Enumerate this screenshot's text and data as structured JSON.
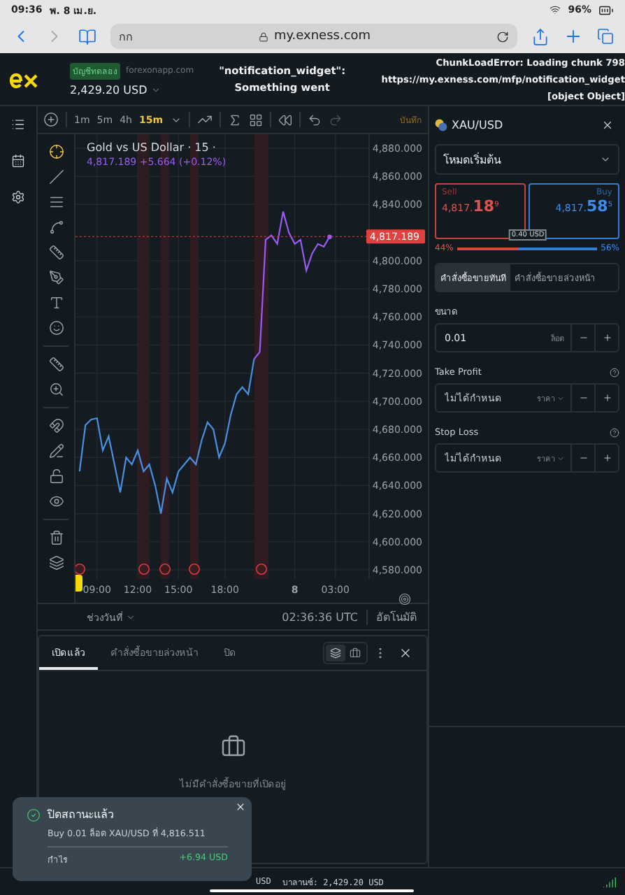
{
  "device_status": {
    "time": "09:36",
    "date": "พ. 8 เม.ย.",
    "battery": "96%"
  },
  "browser": {
    "tab_label": "กก",
    "url": "my.exness.com",
    "back_enabled": true,
    "forward_enabled": false
  },
  "header": {
    "account_badge": "บัญชีทดลอง",
    "domain": "forexonapp.com",
    "balance": "2,429.20 USD",
    "widget_error": [
      "\"notification_widget\":",
      "Something went"
    ],
    "chunk_error": [
      "ChunkLoadError: Loading chunk 798",
      "https://my.exness.com/mfp/notification_widget",
      "[object Object]"
    ]
  },
  "toolbar": {
    "timeframes": [
      {
        "label": "1m",
        "selected": false
      },
      {
        "label": "5m",
        "selected": false
      },
      {
        "label": "4h",
        "selected": false
      },
      {
        "label": "15m",
        "selected": true
      }
    ],
    "save_label": "บันทึก"
  },
  "chart": {
    "title": "Gold vs US Dollar · 15 ·",
    "quote": "4,817.189 +5.664 (+0.12%)",
    "date_range": "ช่วงวันที่",
    "clock": "02:36:36 UTC",
    "scale_mode": "อัตโนมัติ",
    "chart_data": {
      "type": "line",
      "grid": true,
      "ylim": [
        4573.5,
        4890
      ],
      "categories": [
        null,
        null,
        null,
        "09:00",
        null,
        null,
        null,
        null,
        null,
        null,
        "12:00",
        null,
        null,
        null,
        null,
        null,
        null,
        "15:00",
        null,
        null,
        null,
        null,
        null,
        null,
        null,
        "18:00",
        null,
        null,
        null,
        null,
        null,
        null,
        null,
        null,
        null,
        null,
        null,
        "8",
        null,
        null,
        null,
        null,
        null,
        null,
        "03:00"
      ],
      "ref_lines": [
        {
          "axis": "y",
          "value": 4817.189,
          "color": "#cc4444",
          "label": "4,817.189"
        }
      ],
      "yticks": [
        {
          "value": 4880,
          "label": "4,880.000"
        },
        {
          "value": 4860,
          "label": "4,860.000"
        },
        {
          "value": 4840,
          "label": "4,840.000"
        },
        {
          "value": 4800,
          "label": "4,800.000"
        },
        {
          "value": 4780,
          "label": "4,780.000"
        },
        {
          "value": 4760,
          "label": "4,760.000"
        },
        {
          "value": 4740,
          "label": "4,740.000"
        },
        {
          "value": 4720,
          "label": "4,720.000"
        },
        {
          "value": 4700,
          "label": "4,700.000"
        },
        {
          "value": 4680,
          "label": "4,680.000"
        },
        {
          "value": 4660,
          "label": "4,660.000"
        },
        {
          "value": 4640,
          "label": "4,640.000"
        },
        {
          "value": 4620,
          "label": "4,620.000"
        },
        {
          "value": 4600,
          "label": "4,600.000"
        },
        {
          "value": 4580,
          "label": "4,580.000"
        }
      ],
      "series": [
        {
          "color": "#4a90e2",
          "values": [
            4650,
            4683,
            4687,
            4688,
            4665,
            4675,
            4655,
            4635,
            4660,
            4655,
            4665,
            4650,
            4655,
            4640,
            4620,
            4645,
            4635,
            4650,
            4655,
            4660,
            4655,
            4672,
            4685,
            4680,
            4660,
            4670,
            4690,
            4705,
            4710,
            4705,
            4730,
            null,
            null,
            null,
            null,
            null,
            null,
            null,
            null,
            null,
            null,
            null,
            null,
            null,
            null
          ]
        },
        {
          "color": "#9b59f5",
          "values": [
            null,
            null,
            null,
            null,
            null,
            null,
            null,
            null,
            null,
            null,
            null,
            null,
            null,
            null,
            null,
            null,
            null,
            null,
            null,
            null,
            null,
            null,
            null,
            null,
            null,
            null,
            null,
            null,
            null,
            null,
            4730,
            4735,
            4815,
            4818,
            4812,
            4835,
            4820,
            4812,
            4815,
            4793,
            4805,
            4812,
            4810,
            4817,
            null
          ]
        }
      ]
    }
  },
  "trade_panel": {
    "symbol": "XAU/USD",
    "mode": "โหมดเริ่มต้น",
    "sell": {
      "label": "Sell",
      "price": "4,817.**18**$^{9}$"
    },
    "buy": {
      "label": "Buy",
      "price": "4,817.**58**$^{5}$"
    },
    "spread": "0.40 USD",
    "sentiment": {
      "sell_share": "44%",
      "buy_share": "56%",
      "level": 0.44
    },
    "order_tabs": [
      {
        "label": "คำสั่งซื้อขายทันที",
        "selected": true
      },
      {
        "label": "คำสั่งซื้อขายล่วงหน้า",
        "selected": false
      }
    ],
    "fields": [
      {
        "label": "ขนาด",
        "value": "0.01",
        "unit": "ล็อต",
        "help": false,
        "unit_menu": false
      },
      {
        "label": "Take Profit",
        "placeholder": "ไม่ได้กำหนด",
        "unit": "ราคา",
        "help": true,
        "unit_menu": true
      },
      {
        "label": "Stop Loss",
        "placeholder": "ไม่ได้กำหนด",
        "unit": "ราคา",
        "help": true,
        "unit_menu": true
      }
    ]
  },
  "positions": {
    "tabs": [
      {
        "label": "เปิดแล้ว",
        "selected": true
      },
      {
        "label": "คำสั่งซื้อขายล่วงหน้า",
        "selected": false
      },
      {
        "label": "ปิด",
        "selected": false
      }
    ],
    "view_toggles": [
      {
        "selected": true
      },
      {
        "selected": false
      }
    ],
    "empty_message": "ไม่มีคำสั่งซื้อขายที่เปิดอยู่"
  },
  "toast": {
    "title": "ปิดสถานะแล้ว",
    "detail": "Buy 0.01 ล็อต XAU/USD ที่ 4,816.511",
    "profit_label": "กำไร",
    "profit": "+6.94 USD"
  },
  "footer": {
    "currency": "USD",
    "balance": "บาลานซ์: 2,429.20 USD"
  }
}
